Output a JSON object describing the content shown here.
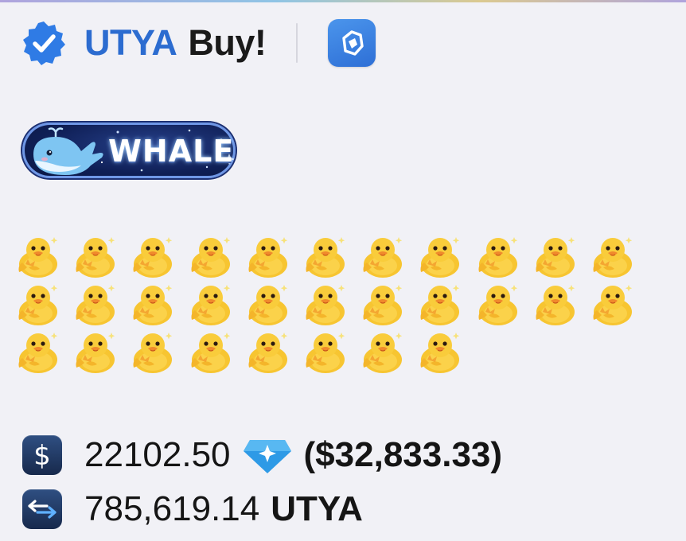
{
  "header": {
    "token": "UTYA",
    "action": "Buy!",
    "verified_icon": "verified-check-icon",
    "app_icon": "app-logo-icon",
    "accent_color": "#2c6cd0"
  },
  "badge": {
    "label": "WHALE",
    "icon": "whale-icon"
  },
  "ducks": {
    "count": 30,
    "per_row": 11,
    "icon": "duck-emoji"
  },
  "stats": {
    "ton_amount": "22102.50",
    "ton_icon": "ton-diamond-icon",
    "usd_value": "($32,833.33)",
    "token_amount": "785,619.14",
    "token_symbol": "UTYA"
  }
}
